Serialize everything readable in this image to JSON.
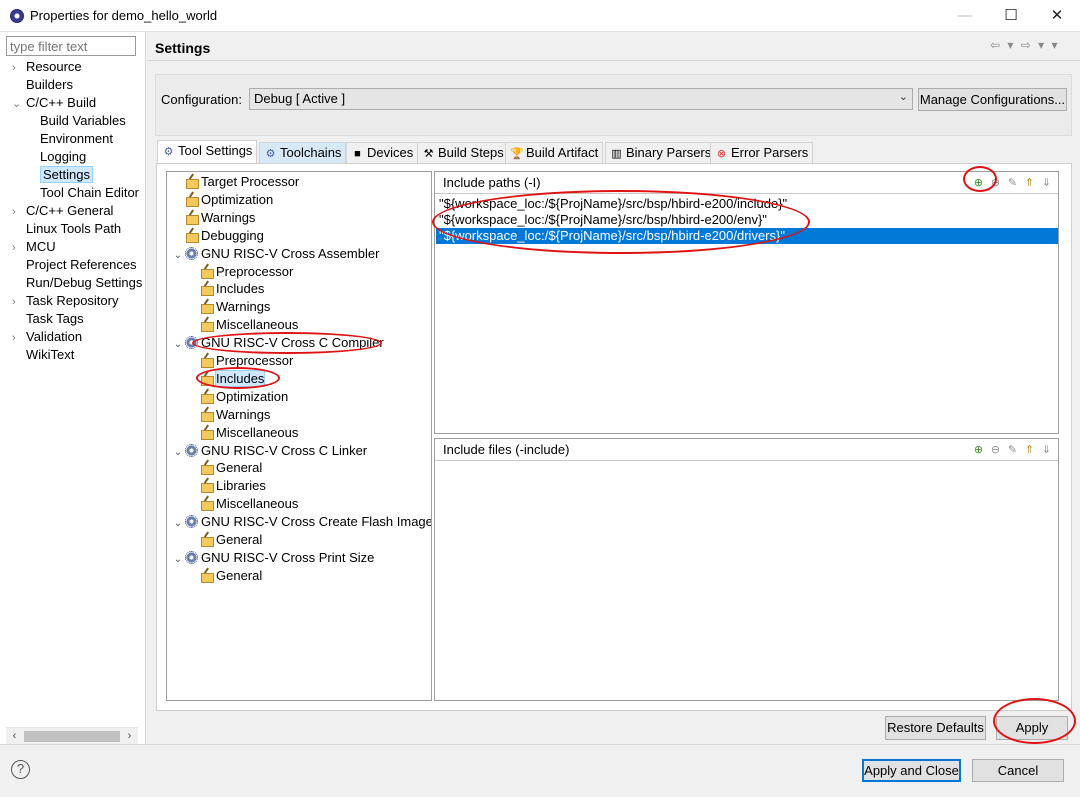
{
  "window": {
    "title": "Properties for demo_hello_world",
    "minimize_glyph": "—",
    "maximize_glyph": "☐",
    "close_glyph": "✕"
  },
  "sidebar": {
    "filter_placeholder": "type filter text",
    "items": [
      {
        "label": "Resource",
        "expander": "›"
      },
      {
        "label": "Builders",
        "expander": ""
      },
      {
        "label": "C/C++ Build",
        "expander": "⌄"
      },
      {
        "label": "Build Variables",
        "expander": ""
      },
      {
        "label": "Environment",
        "expander": ""
      },
      {
        "label": "Logging",
        "expander": ""
      },
      {
        "label": "Settings",
        "expander": "",
        "selected": true
      },
      {
        "label": "Tool Chain Editor",
        "expander": ""
      },
      {
        "label": "C/C++ General",
        "expander": "›"
      },
      {
        "label": "Linux Tools Path",
        "expander": ""
      },
      {
        "label": "MCU",
        "expander": "›"
      },
      {
        "label": "Project References",
        "expander": ""
      },
      {
        "label": "Run/Debug Settings",
        "expander": ""
      },
      {
        "label": "Task Repository",
        "expander": "›"
      },
      {
        "label": "Task Tags",
        "expander": ""
      },
      {
        "label": "Validation",
        "expander": "›"
      },
      {
        "label": "WikiText",
        "expander": ""
      }
    ],
    "scroll_left": "‹",
    "scroll_right": "›"
  },
  "header": {
    "title": "Settings",
    "nav_arrows": "⇦ ▾ ⇨ ▾ ▾"
  },
  "configuration": {
    "label": "Configuration:",
    "value": "Debug  [ Active ]",
    "chevron": "⌄",
    "manage_button": "Manage Configurations..."
  },
  "tabs": [
    {
      "label": "Tool Settings",
      "icon": "⚙",
      "active": true
    },
    {
      "label": "Toolchains",
      "icon": "⚙"
    },
    {
      "label": "Devices",
      "icon": "■"
    },
    {
      "label": "Build Steps",
      "icon": "⚒"
    },
    {
      "label": "Build Artifact",
      "icon": "🏆"
    },
    {
      "label": "Binary Parsers",
      "icon": "▥"
    },
    {
      "label": "Error Parsers",
      "icon": "⊗"
    }
  ],
  "tool_tree": [
    {
      "label": "Target Processor",
      "kind": "leaf",
      "level": 0
    },
    {
      "label": "Optimization",
      "kind": "leaf",
      "level": 0
    },
    {
      "label": "Warnings",
      "kind": "leaf",
      "level": 0
    },
    {
      "label": "Debugging",
      "kind": "leaf",
      "level": 0
    },
    {
      "label": "GNU RISC-V Cross Assembler",
      "kind": "tool",
      "level": 0
    },
    {
      "label": "Preprocessor",
      "kind": "leaf",
      "level": 1
    },
    {
      "label": "Includes",
      "kind": "leaf",
      "level": 1
    },
    {
      "label": "Warnings",
      "kind": "leaf",
      "level": 1
    },
    {
      "label": "Miscellaneous",
      "kind": "leaf",
      "level": 1
    },
    {
      "label": "GNU RISC-V Cross C Compiler",
      "kind": "tool",
      "level": 0
    },
    {
      "label": "Preprocessor",
      "kind": "leaf",
      "level": 1
    },
    {
      "label": "Includes",
      "kind": "leaf",
      "level": 1,
      "selected": true
    },
    {
      "label": "Optimization",
      "kind": "leaf",
      "level": 1
    },
    {
      "label": "Warnings",
      "kind": "leaf",
      "level": 1
    },
    {
      "label": "Miscellaneous",
      "kind": "leaf",
      "level": 1
    },
    {
      "label": "GNU RISC-V Cross C Linker",
      "kind": "tool",
      "level": 0
    },
    {
      "label": "General",
      "kind": "leaf",
      "level": 1
    },
    {
      "label": "Libraries",
      "kind": "leaf",
      "level": 1
    },
    {
      "label": "Miscellaneous",
      "kind": "leaf",
      "level": 1
    },
    {
      "label": "GNU RISC-V Cross Create Flash Image",
      "kind": "tool",
      "level": 0
    },
    {
      "label": "General",
      "kind": "leaf",
      "level": 1
    },
    {
      "label": "GNU RISC-V Cross Print Size",
      "kind": "tool",
      "level": 0
    },
    {
      "label": "General",
      "kind": "leaf",
      "level": 1
    }
  ],
  "include_paths": {
    "label": "Include paths (-I)",
    "items": [
      "\"${workspace_loc:/${ProjName}/src/bsp/hbird-e200/include}\"",
      "\"${workspace_loc:/${ProjName}/src/bsp/hbird-e200/env}\"",
      "\"${workspace_loc:/${ProjName}/src/bsp/hbird-e200/drivers}\""
    ],
    "selected_index": 2
  },
  "include_files": {
    "label": "Include files (-include)",
    "items": []
  },
  "toolbar_icons": [
    "add-icon",
    "delete-icon",
    "edit-icon",
    "move-up-icon",
    "move-down-icon"
  ],
  "buttons": {
    "restore_defaults": "Restore Defaults",
    "apply": "Apply",
    "apply_and_close": "Apply and Close",
    "cancel": "Cancel"
  },
  "help_glyph": "?",
  "colors": {
    "selection": "#0078d7",
    "annotation": "#e01212"
  }
}
